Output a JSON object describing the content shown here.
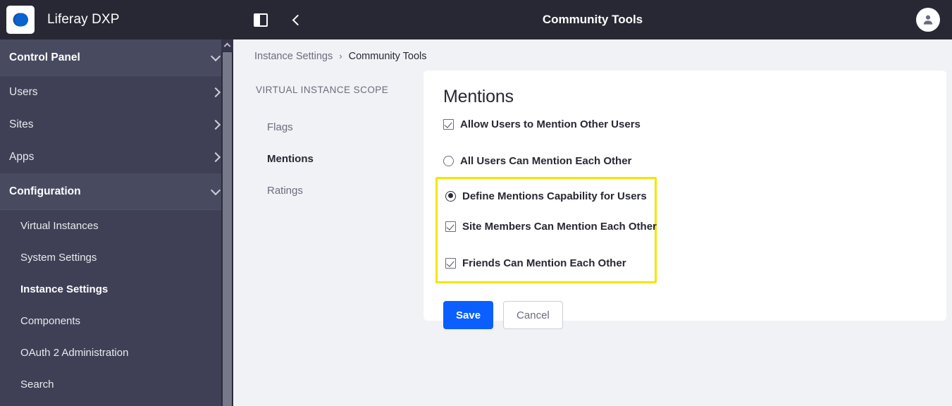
{
  "brand": {
    "title": "Liferay DXP",
    "logo_icon": "liferay-logo-icon"
  },
  "sidebar": {
    "groups": [
      {
        "label": "Control Panel",
        "icon": "chevron-down-icon",
        "type": "group-header"
      }
    ],
    "items": [
      {
        "label": "Users",
        "icon": "chevron-right-icon",
        "type": "item"
      },
      {
        "label": "Sites",
        "icon": "chevron-right-icon",
        "type": "item"
      },
      {
        "label": "Apps",
        "icon": "chevron-right-icon",
        "type": "item"
      }
    ],
    "configuration": {
      "label": "Configuration",
      "icon": "chevron-down-icon",
      "children": [
        {
          "label": "Virtual Instances",
          "active": false
        },
        {
          "label": "System Settings",
          "active": false
        },
        {
          "label": "Instance Settings",
          "active": true
        },
        {
          "label": "Components",
          "active": false
        },
        {
          "label": "OAuth 2 Administration",
          "active": false
        },
        {
          "label": "Search",
          "active": false
        }
      ]
    },
    "scrollbar": {
      "up_arrow_icon": "chevron-up-icon"
    }
  },
  "topbar": {
    "title": "Community Tools",
    "panel_toggle_icon": "sidebar-toggle-icon",
    "back_icon": "chevron-left-icon",
    "avatar_icon": "user-avatar-icon"
  },
  "breadcrumb": {
    "items": [
      {
        "label": "Instance Settings",
        "current": false
      },
      {
        "label": "Community Tools",
        "current": true
      }
    ],
    "separator": "›"
  },
  "subnav": {
    "title": "VIRTUAL INSTANCE SCOPE",
    "items": [
      {
        "label": "Flags",
        "active": false
      },
      {
        "label": "Mentions",
        "active": true
      },
      {
        "label": "Ratings",
        "active": false
      }
    ]
  },
  "card": {
    "title": "Mentions",
    "allow_mentions": {
      "label": "Allow Users to Mention Other Users",
      "checked": true
    },
    "radio_all_users": {
      "label": "All Users Can Mention Each Other",
      "selected": false
    },
    "highlight_color": "#f5e500",
    "radio_define": {
      "label": "Define Mentions Capability for Users",
      "selected": true
    },
    "check_site_members": {
      "label": "Site Members Can Mention Each Other",
      "checked": true
    },
    "check_friends": {
      "label": "Friends Can Mention Each Other",
      "checked": true
    },
    "save_label": "Save",
    "cancel_label": "Cancel"
  },
  "colors": {
    "topbar_bg": "#272833",
    "sidebar_bg": "#3f4055",
    "sidebar_group_bg": "#484a60",
    "page_bg": "#f1f2f5",
    "primary": "#0b5fff",
    "highlight": "#f5e500"
  }
}
